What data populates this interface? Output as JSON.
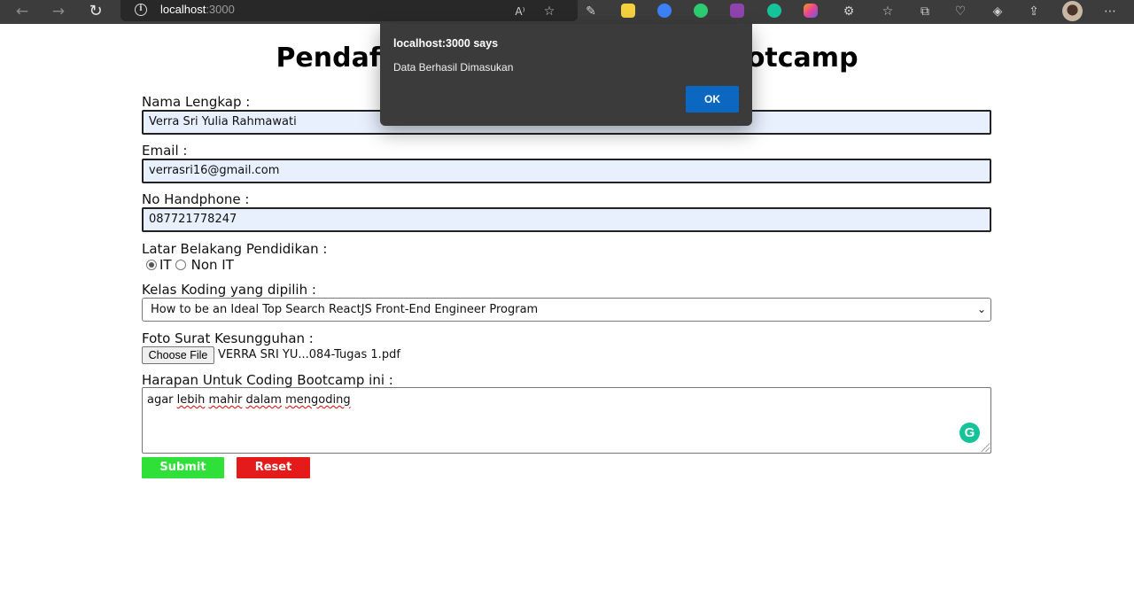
{
  "browser": {
    "url_host": "localhost",
    "url_port": ":3000",
    "back_icon": "←",
    "forward_icon": "→",
    "reload_icon": "↻",
    "info_icon": "i",
    "more_icon": "⋯"
  },
  "page": {
    "title": "Pendaftaran Peserta Coding Bootcamp"
  },
  "form": {
    "nama_label": "Nama Lengkap :",
    "nama_value": "Verra Sri Yulia Rahmawati",
    "email_label": "Email :",
    "email_value": "verrasri16@gmail.com",
    "hp_label": "No Handphone :",
    "hp_value": "087721778247",
    "latar_label": "Latar Belakang Pendidikan :",
    "radio_it": "IT",
    "radio_non_it": "Non IT",
    "kelas_label": "Kelas Koding yang dipilih :",
    "kelas_value": "How to be an Ideal Top Search ReactJS Front-End Engineer Program",
    "foto_label": "Foto Surat Kesungguhan :",
    "choose_file": "Choose File",
    "file_name": "VERRA SRI YU...084-Tugas 1.pdf",
    "harapan_label": "Harapan Untuk Coding Bootcamp ini :",
    "harapan_word1": "agar",
    "harapan_word2": "lebih",
    "harapan_word3": "mahir",
    "harapan_word4": "dalam",
    "harapan_word5": "mengoding",
    "submit": "Submit",
    "reset": "Reset",
    "grammarly": "G"
  },
  "dialog": {
    "title": "localhost:3000 says",
    "message": "Data Berhasil Dimasukan",
    "ok": "OK"
  }
}
